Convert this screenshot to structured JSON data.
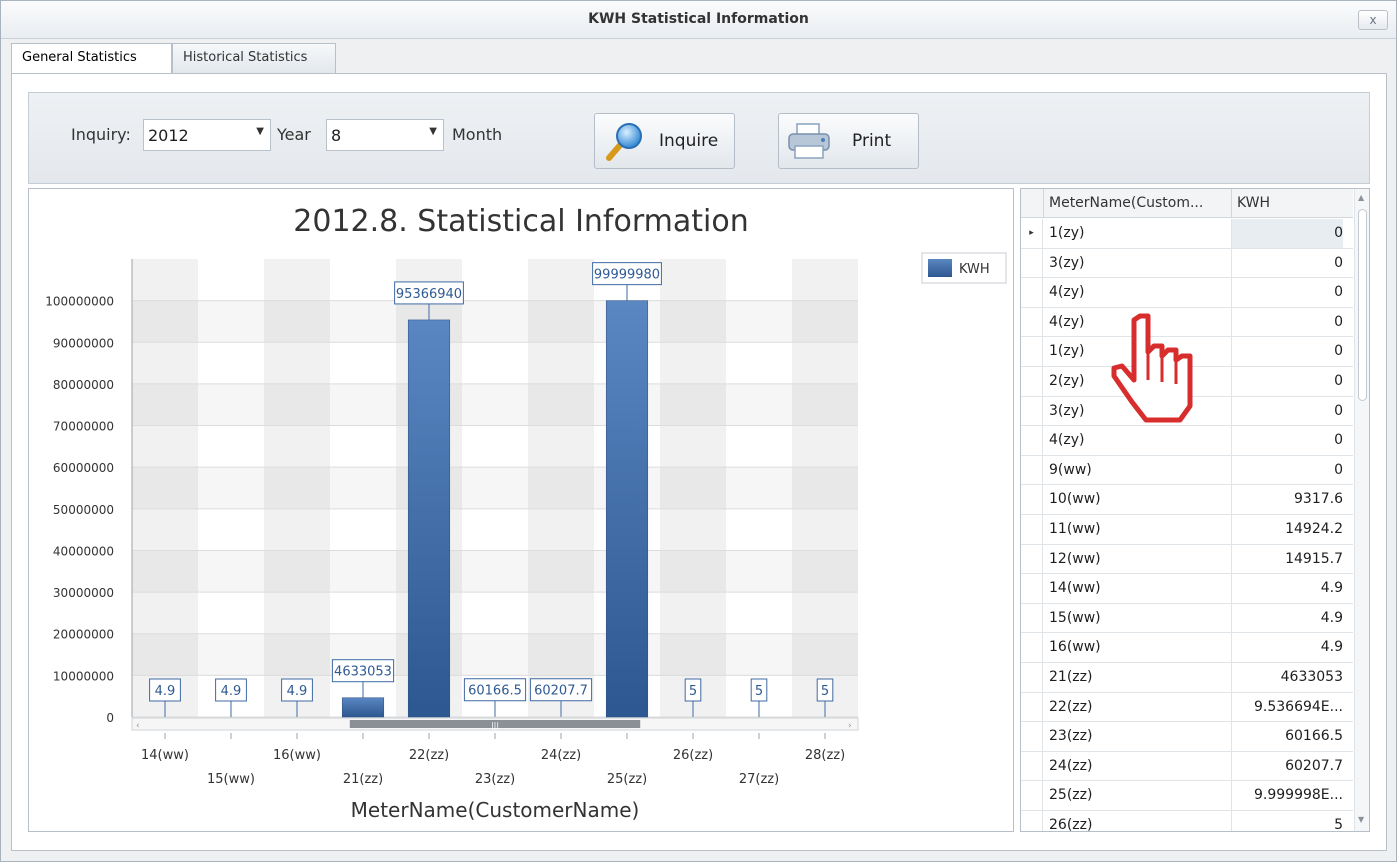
{
  "window": {
    "title": "KWH Statistical Information",
    "close_label": "x"
  },
  "tabs": [
    {
      "label": "General Statistics",
      "active": true
    },
    {
      "label": "Historical Statistics",
      "active": false
    }
  ],
  "toolbar": {
    "inquiry_label": "Inquiry:",
    "year_value": "2012",
    "year_label": "Year",
    "month_value": "8",
    "month_label": "Month",
    "inquire_label": "Inquire",
    "print_label": "Print",
    "inquire_icon": "magnifier-icon",
    "print_icon": "printer-icon"
  },
  "colors": {
    "bar": "#3f6aa3",
    "accent": "#2f5a93"
  },
  "chart_data": {
    "type": "bar",
    "title": "2012.8. Statistical Information",
    "xlabel": "MeterName(CustomerName)",
    "ylabel": "",
    "legend": [
      "KWH"
    ],
    "legend_position": "top-right",
    "ylim": [
      0,
      110000000
    ],
    "yticks": [
      0,
      10000000,
      20000000,
      30000000,
      40000000,
      50000000,
      60000000,
      70000000,
      80000000,
      90000000,
      100000000
    ],
    "ytick_labels": [
      "0",
      "10000000",
      "20000000",
      "30000000",
      "40000000",
      "50000000",
      "60000000",
      "70000000",
      "80000000",
      "90000000",
      "100000000"
    ],
    "categories": [
      "14(ww)",
      "15(ww)",
      "16(ww)",
      "21(zz)",
      "22(zz)",
      "23(zz)",
      "24(zz)",
      "25(zz)",
      "26(zz)",
      "27(zz)",
      "28(zz)"
    ],
    "series": [
      {
        "name": "KWH",
        "values": [
          4.9,
          4.9,
          4.9,
          4633053,
          95366940,
          60166.5,
          60207.7,
          99999980,
          5,
          5,
          5
        ]
      }
    ],
    "data_labels": [
      "4.9",
      "4.9",
      "4.9",
      "4633053",
      "95366940",
      "60166.5",
      "60207.7",
      "99999980",
      "5",
      "5",
      "5"
    ],
    "scrollbar_indicator": "|||"
  },
  "grid": {
    "columns": [
      "MeterName(Custom...",
      "KWH"
    ],
    "rows": [
      {
        "name": "1(zy)",
        "kwh": "0"
      },
      {
        "name": "3(zy)",
        "kwh": "0"
      },
      {
        "name": "4(zy)",
        "kwh": "0"
      },
      {
        "name": "4(zy)",
        "kwh": "0"
      },
      {
        "name": "1(zy)",
        "kwh": "0"
      },
      {
        "name": "2(zy)",
        "kwh": "0"
      },
      {
        "name": "3(zy)",
        "kwh": "0"
      },
      {
        "name": "4(zy)",
        "kwh": "0"
      },
      {
        "name": "9(ww)",
        "kwh": "0"
      },
      {
        "name": "10(ww)",
        "kwh": "9317.6"
      },
      {
        "name": "11(ww)",
        "kwh": "14924.2"
      },
      {
        "name": "12(ww)",
        "kwh": "14915.7"
      },
      {
        "name": "14(ww)",
        "kwh": "4.9"
      },
      {
        "name": "15(ww)",
        "kwh": "4.9"
      },
      {
        "name": "16(ww)",
        "kwh": "4.9"
      },
      {
        "name": "21(zz)",
        "kwh": "4633053"
      },
      {
        "name": "22(zz)",
        "kwh": "9.536694E..."
      },
      {
        "name": "23(zz)",
        "kwh": "60166.5"
      },
      {
        "name": "24(zz)",
        "kwh": "60207.7"
      },
      {
        "name": "25(zz)",
        "kwh": "9.999998E..."
      },
      {
        "name": "26(zz)",
        "kwh": "5"
      }
    ],
    "selected_row_indicator": "▸"
  },
  "cursor_icon": "hand-pointer-icon"
}
